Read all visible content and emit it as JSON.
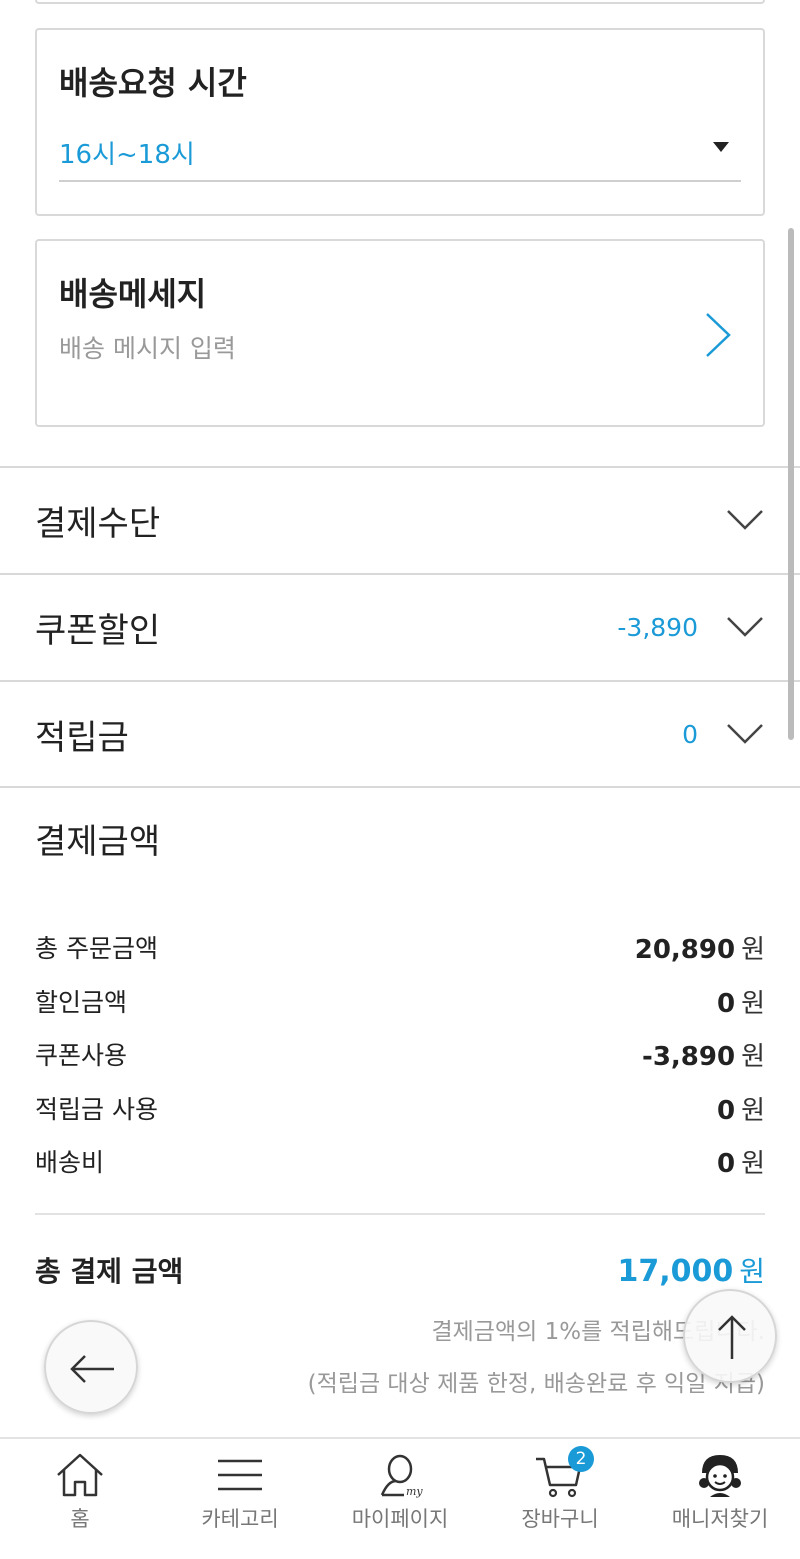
{
  "delivery_time": {
    "title": "배송요청 시간",
    "selected": "16시~18시"
  },
  "delivery_message": {
    "title": "배송메세지",
    "placeholder": "배송 메시지 입력"
  },
  "sections": {
    "payment_method": {
      "label": "결제수단"
    },
    "coupon": {
      "label": "쿠폰할인",
      "value": "-3,890"
    },
    "points": {
      "label": "적립금",
      "value": "0"
    }
  },
  "payment_summary": {
    "title": "결제금액",
    "lines": [
      {
        "label": "총 주문금액",
        "amount": "20,890",
        "unit": "원"
      },
      {
        "label": "할인금액",
        "amount": "0",
        "unit": "원"
      },
      {
        "label": "쿠폰사용",
        "amount": "-3,890",
        "unit": "원"
      },
      {
        "label": "적립금 사용",
        "amount": "0",
        "unit": "원"
      },
      {
        "label": "배송비",
        "amount": "0",
        "unit": "원"
      }
    ],
    "total": {
      "label": "총 결제 금액",
      "amount": "17,000",
      "unit": "원"
    },
    "note_line1": "결제금액의 1%를 적립해드립니다.",
    "note_line2": "(적립금 대상 제품 한정, 배송완료 후 익일 지급)"
  },
  "bottom_nav": {
    "items": [
      {
        "label": "홈",
        "icon": "home-icon"
      },
      {
        "label": "카테고리",
        "icon": "menu-icon"
      },
      {
        "label": "마이페이지",
        "icon": "mypage-icon"
      },
      {
        "label": "장바구니",
        "icon": "cart-icon"
      },
      {
        "label": "매니저찾기",
        "icon": "manager-icon"
      }
    ],
    "cart_badge": "2"
  },
  "colors": {
    "accent": "#1a9ad6",
    "border": "#d9d9d9"
  }
}
